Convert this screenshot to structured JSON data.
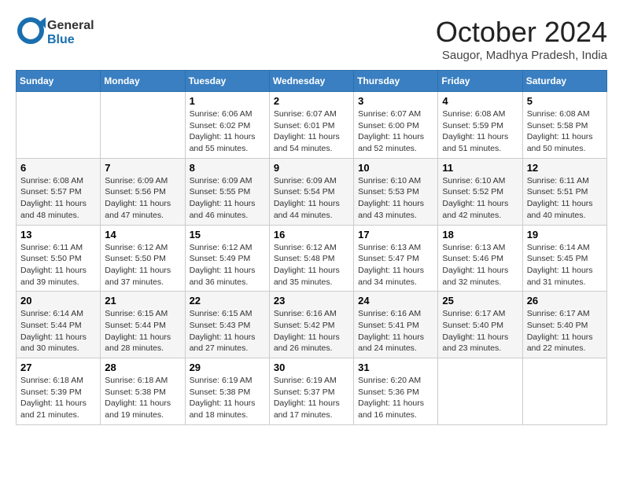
{
  "header": {
    "logo": {
      "line1": "General",
      "line2": "Blue"
    },
    "title": "October 2024",
    "subtitle": "Saugor, Madhya Pradesh, India"
  },
  "weekdays": [
    "Sunday",
    "Monday",
    "Tuesday",
    "Wednesday",
    "Thursday",
    "Friday",
    "Saturday"
  ],
  "weeks": [
    [
      {
        "day": "",
        "info": ""
      },
      {
        "day": "",
        "info": ""
      },
      {
        "day": "1",
        "info": "Sunrise: 6:06 AM\nSunset: 6:02 PM\nDaylight: 11 hours and 55 minutes."
      },
      {
        "day": "2",
        "info": "Sunrise: 6:07 AM\nSunset: 6:01 PM\nDaylight: 11 hours and 54 minutes."
      },
      {
        "day": "3",
        "info": "Sunrise: 6:07 AM\nSunset: 6:00 PM\nDaylight: 11 hours and 52 minutes."
      },
      {
        "day": "4",
        "info": "Sunrise: 6:08 AM\nSunset: 5:59 PM\nDaylight: 11 hours and 51 minutes."
      },
      {
        "day": "5",
        "info": "Sunrise: 6:08 AM\nSunset: 5:58 PM\nDaylight: 11 hours and 50 minutes."
      }
    ],
    [
      {
        "day": "6",
        "info": "Sunrise: 6:08 AM\nSunset: 5:57 PM\nDaylight: 11 hours and 48 minutes."
      },
      {
        "day": "7",
        "info": "Sunrise: 6:09 AM\nSunset: 5:56 PM\nDaylight: 11 hours and 47 minutes."
      },
      {
        "day": "8",
        "info": "Sunrise: 6:09 AM\nSunset: 5:55 PM\nDaylight: 11 hours and 46 minutes."
      },
      {
        "day": "9",
        "info": "Sunrise: 6:09 AM\nSunset: 5:54 PM\nDaylight: 11 hours and 44 minutes."
      },
      {
        "day": "10",
        "info": "Sunrise: 6:10 AM\nSunset: 5:53 PM\nDaylight: 11 hours and 43 minutes."
      },
      {
        "day": "11",
        "info": "Sunrise: 6:10 AM\nSunset: 5:52 PM\nDaylight: 11 hours and 42 minutes."
      },
      {
        "day": "12",
        "info": "Sunrise: 6:11 AM\nSunset: 5:51 PM\nDaylight: 11 hours and 40 minutes."
      }
    ],
    [
      {
        "day": "13",
        "info": "Sunrise: 6:11 AM\nSunset: 5:50 PM\nDaylight: 11 hours and 39 minutes."
      },
      {
        "day": "14",
        "info": "Sunrise: 6:12 AM\nSunset: 5:50 PM\nDaylight: 11 hours and 37 minutes."
      },
      {
        "day": "15",
        "info": "Sunrise: 6:12 AM\nSunset: 5:49 PM\nDaylight: 11 hours and 36 minutes."
      },
      {
        "day": "16",
        "info": "Sunrise: 6:12 AM\nSunset: 5:48 PM\nDaylight: 11 hours and 35 minutes."
      },
      {
        "day": "17",
        "info": "Sunrise: 6:13 AM\nSunset: 5:47 PM\nDaylight: 11 hours and 34 minutes."
      },
      {
        "day": "18",
        "info": "Sunrise: 6:13 AM\nSunset: 5:46 PM\nDaylight: 11 hours and 32 minutes."
      },
      {
        "day": "19",
        "info": "Sunrise: 6:14 AM\nSunset: 5:45 PM\nDaylight: 11 hours and 31 minutes."
      }
    ],
    [
      {
        "day": "20",
        "info": "Sunrise: 6:14 AM\nSunset: 5:44 PM\nDaylight: 11 hours and 30 minutes."
      },
      {
        "day": "21",
        "info": "Sunrise: 6:15 AM\nSunset: 5:44 PM\nDaylight: 11 hours and 28 minutes."
      },
      {
        "day": "22",
        "info": "Sunrise: 6:15 AM\nSunset: 5:43 PM\nDaylight: 11 hours and 27 minutes."
      },
      {
        "day": "23",
        "info": "Sunrise: 6:16 AM\nSunset: 5:42 PM\nDaylight: 11 hours and 26 minutes."
      },
      {
        "day": "24",
        "info": "Sunrise: 6:16 AM\nSunset: 5:41 PM\nDaylight: 11 hours and 24 minutes."
      },
      {
        "day": "25",
        "info": "Sunrise: 6:17 AM\nSunset: 5:40 PM\nDaylight: 11 hours and 23 minutes."
      },
      {
        "day": "26",
        "info": "Sunrise: 6:17 AM\nSunset: 5:40 PM\nDaylight: 11 hours and 22 minutes."
      }
    ],
    [
      {
        "day": "27",
        "info": "Sunrise: 6:18 AM\nSunset: 5:39 PM\nDaylight: 11 hours and 21 minutes."
      },
      {
        "day": "28",
        "info": "Sunrise: 6:18 AM\nSunset: 5:38 PM\nDaylight: 11 hours and 19 minutes."
      },
      {
        "day": "29",
        "info": "Sunrise: 6:19 AM\nSunset: 5:38 PM\nDaylight: 11 hours and 18 minutes."
      },
      {
        "day": "30",
        "info": "Sunrise: 6:19 AM\nSunset: 5:37 PM\nDaylight: 11 hours and 17 minutes."
      },
      {
        "day": "31",
        "info": "Sunrise: 6:20 AM\nSunset: 5:36 PM\nDaylight: 11 hours and 16 minutes."
      },
      {
        "day": "",
        "info": ""
      },
      {
        "day": "",
        "info": ""
      }
    ]
  ]
}
